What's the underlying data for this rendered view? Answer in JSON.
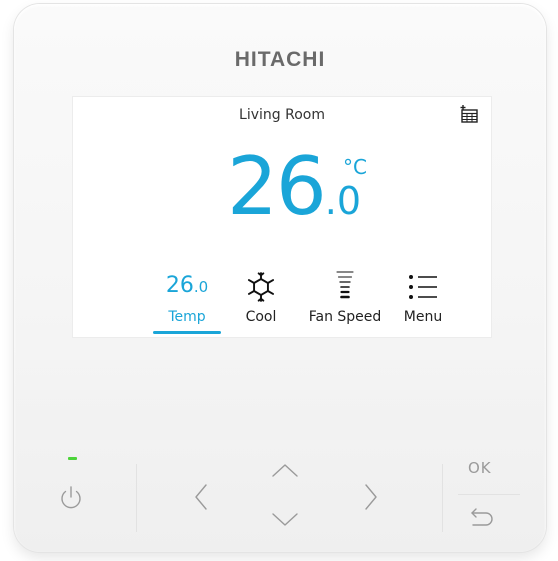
{
  "device": {
    "brand": "HITACHI"
  },
  "screen": {
    "room_name": "Living Room",
    "set_temp_integer": "26",
    "set_temp_decimal": ".0",
    "unit": "°C",
    "schedule_icon": "calendar-add-icon"
  },
  "menu": {
    "items": [
      {
        "id": "temp",
        "value_integer": "26",
        "value_decimal": ".0",
        "label": "Temp",
        "selected": true
      },
      {
        "id": "mode",
        "icon": "snowflake-icon",
        "label": "Cool"
      },
      {
        "id": "fan",
        "icon": "fan-speed-icon",
        "label": "Fan Speed"
      },
      {
        "id": "menu",
        "icon": "list-icon",
        "label": "Menu"
      }
    ]
  },
  "buttons": {
    "power_icon": "power-icon",
    "left_icon": "chevron-left-icon",
    "up_icon": "chevron-up-icon",
    "down_icon": "chevron-down-icon",
    "right_icon": "chevron-right-icon",
    "ok_label": "OK",
    "back_icon": "back-arrow-icon"
  },
  "colors": {
    "accent": "#1aa5d8",
    "led": "#4cd43a",
    "text": "#222222",
    "brand": "#6a6a6a"
  }
}
